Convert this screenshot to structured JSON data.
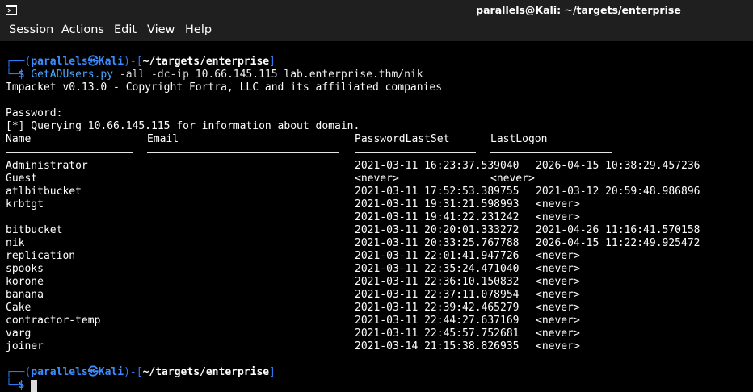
{
  "window": {
    "title": "parallels@Kali: ~/targets/enterprise",
    "icon": "terminal-icon"
  },
  "menu": [
    "Session",
    "Actions",
    "Edit",
    "View",
    "Help"
  ],
  "prompt1": {
    "frame_top": "┌──(",
    "user": "parallels",
    "at": "㉿",
    "host": "Kali",
    "mid": ")-[",
    "path": "~/targets/enterprise",
    "end": "]",
    "frame_bottom": "└─",
    "dollar": "$",
    "command": "GetADUsers.py",
    "args": " -all -dc-ip",
    "rest": " 10.66.145.115 lab.enterprise.thm/nik"
  },
  "output": {
    "banner": "Impacket v0.13.0 - Copyright Fortra, LLC and its affiliated companies",
    "password": "Password:",
    "query": "[*] Querying 10.66.145.115 for information about domain.",
    "headers": [
      "Name",
      "Email",
      "PasswordLastSet",
      "LastLogon"
    ],
    "rows": [
      {
        "name": "Administrator",
        "email": "",
        "pwd": "2021-03-11 16:23:37.539040",
        "logon": "2026-04-15 10:38:29.457236"
      },
      {
        "name": "Guest",
        "email": "",
        "pwd": "<never>",
        "logon": "<never>"
      },
      {
        "name": "atlbitbucket",
        "email": "",
        "pwd": "2021-03-11 17:52:53.389755",
        "logon": "2021-03-12 20:59:48.986896"
      },
      {
        "name": "krbtgt",
        "email": "",
        "pwd": "2021-03-11 19:31:21.598993",
        "logon": "<never>"
      },
      {
        "name": "",
        "email": "",
        "pwd": "2021-03-11 19:41:22.231242",
        "logon": "<never>"
      },
      {
        "name": "bitbucket",
        "email": "",
        "pwd": "2021-03-11 20:20:01.333272",
        "logon": "2021-04-26 11:16:41.570158"
      },
      {
        "name": "nik",
        "email": "",
        "pwd": "2021-03-11 20:33:25.767788",
        "logon": "2026-04-15 11:22:49.925472"
      },
      {
        "name": "replication",
        "email": "",
        "pwd": "2021-03-11 22:01:41.947726",
        "logon": "<never>"
      },
      {
        "name": "spooks",
        "email": "",
        "pwd": "2021-03-11 22:35:24.471040",
        "logon": "<never>"
      },
      {
        "name": "korone",
        "email": "",
        "pwd": "2021-03-11 22:36:10.150832",
        "logon": "<never>"
      },
      {
        "name": "banana",
        "email": "",
        "pwd": "2021-03-11 22:37:11.078954",
        "logon": "<never>"
      },
      {
        "name": "Cake",
        "email": "",
        "pwd": "2021-03-11 22:39:42.465279",
        "logon": "<never>"
      },
      {
        "name": "contractor-temp",
        "email": "",
        "pwd": "2021-03-11 22:44:27.637169",
        "logon": "<never>"
      },
      {
        "name": "varg",
        "email": "",
        "pwd": "2021-03-11 22:45:57.752681",
        "logon": "<never>"
      },
      {
        "name": "joiner",
        "email": "",
        "pwd": "2021-03-14 21:15:38.826935",
        "logon": "<never>"
      }
    ]
  },
  "prompt2": {
    "frame_top": "┌──(",
    "user": "parallels",
    "at": "㉿",
    "host": "Kali",
    "mid": ")-[",
    "path": "~/targets/enterprise",
    "end": "]",
    "frame_bottom": "└─",
    "dollar": "$"
  },
  "colors": {
    "background": "#000000",
    "titlebar": "#1f1f1f",
    "prompt_frame": "#2f78f0",
    "prompt_user": "#3d8cff",
    "dollar": "#25b25c",
    "command": "#4aa6ff",
    "text": "#ffffff"
  }
}
